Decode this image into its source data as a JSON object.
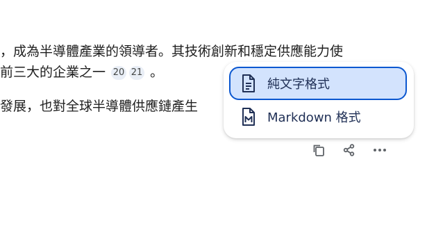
{
  "response": {
    "line1": "，成為半導體產業的領導者。其技術創新和穩定供應能力使",
    "line2_before": "前三大的企業之一",
    "citations": [
      "20",
      "21"
    ],
    "line2_after": "。",
    "line3": "發展，也對全球半導體供應鏈產生"
  },
  "export_menu": {
    "items": [
      {
        "label": "純文字格式",
        "icon": "document-icon",
        "selected": true
      },
      {
        "label": "Markdown 格式",
        "icon": "markdown-file-icon",
        "selected": false
      }
    ],
    "accent_color": "#0b57d0",
    "selected_bg": "#d3e3fd"
  },
  "actions": {
    "icons": [
      "copy-icon",
      "share-icon",
      "more-vert-icon"
    ]
  }
}
